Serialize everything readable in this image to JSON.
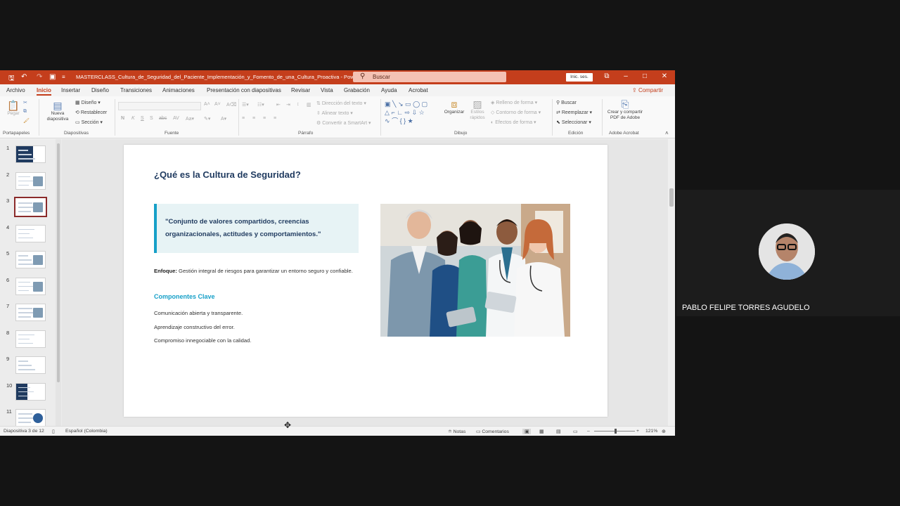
{
  "window": {
    "title": "MASTERCLASS_Cultura_de_Seguridad_del_Paciente_Implementación_y_Fomento_de_una_Cultura_Proactiva - PowerPoint",
    "search_placeholder": "Buscar",
    "signin_label": "Inic. ses.",
    "share_label": "Compartir"
  },
  "ribbon_tabs": [
    "Archivo",
    "Inicio",
    "Insertar",
    "Diseño",
    "Transiciones",
    "Animaciones",
    "Presentación con diapositivas",
    "Revisar",
    "Vista",
    "Grabación",
    "Ayuda",
    "Acrobat"
  ],
  "ribbon": {
    "groups": {
      "portapapeles": "Portapapeles",
      "diapositivas": "Diapositivas",
      "fuente": "Fuente",
      "parrafo": "Párrafo",
      "dibujo": "Dibujo",
      "edicion": "Edición",
      "adobe": "Adobe Acrobat"
    },
    "pegar": "Pegar",
    "nueva_diapositiva": "Nueva diapositiva",
    "diseno": "Diseño",
    "restablecer": "Restablecer",
    "seccion": "Sección",
    "direccion_texto": "Dirección del texto",
    "alinear_texto": "Alinear texto",
    "convertir_smartart": "Convertir a SmartArt",
    "organizar": "Organizar",
    "estilos_rapidos": "Estilos rápidos",
    "relleno_forma": "Relleno de forma",
    "contorno_forma": "Contorno de forma",
    "efectos_forma": "Efectos de forma",
    "buscar": "Buscar",
    "reemplazar": "Reemplazar",
    "seleccionar": "Seleccionar",
    "crear_pdf": "Crear y compartir PDF de Adobe"
  },
  "thumbnails": {
    "numbers": [
      "1",
      "2",
      "3",
      "4",
      "5",
      "6",
      "7",
      "8",
      "9",
      "10",
      "11"
    ],
    "active_index": 2
  },
  "slide": {
    "title": "¿Qué es la Cultura de Seguridad?",
    "quote": "\"Conjunto de valores compartidos, creencias organizacionales, actitudes y comportamientos.\"",
    "enfoque_label": "Enfoque:",
    "enfoque_text": "Gestión integral de riesgos para garantizar un entorno seguro y confiable.",
    "components_title": "Componentes Clave",
    "components": [
      "Comunicación abierta y transparente.",
      "Aprendizaje constructivo del error.",
      "Compromiso innegociable con la calidad."
    ]
  },
  "statusbar": {
    "slide_count": "Diapositiva 3 de 12",
    "language": "Español (Colombia)",
    "notes": "Notas",
    "comments": "Comentarios",
    "zoom": "121%"
  },
  "video": {
    "participant_name": "PABLO FELIPE TORRES AGUDELO"
  },
  "colors": {
    "accent": "#c43e1c",
    "slide_title": "#1f3a5f",
    "teal": "#17a0c8"
  }
}
